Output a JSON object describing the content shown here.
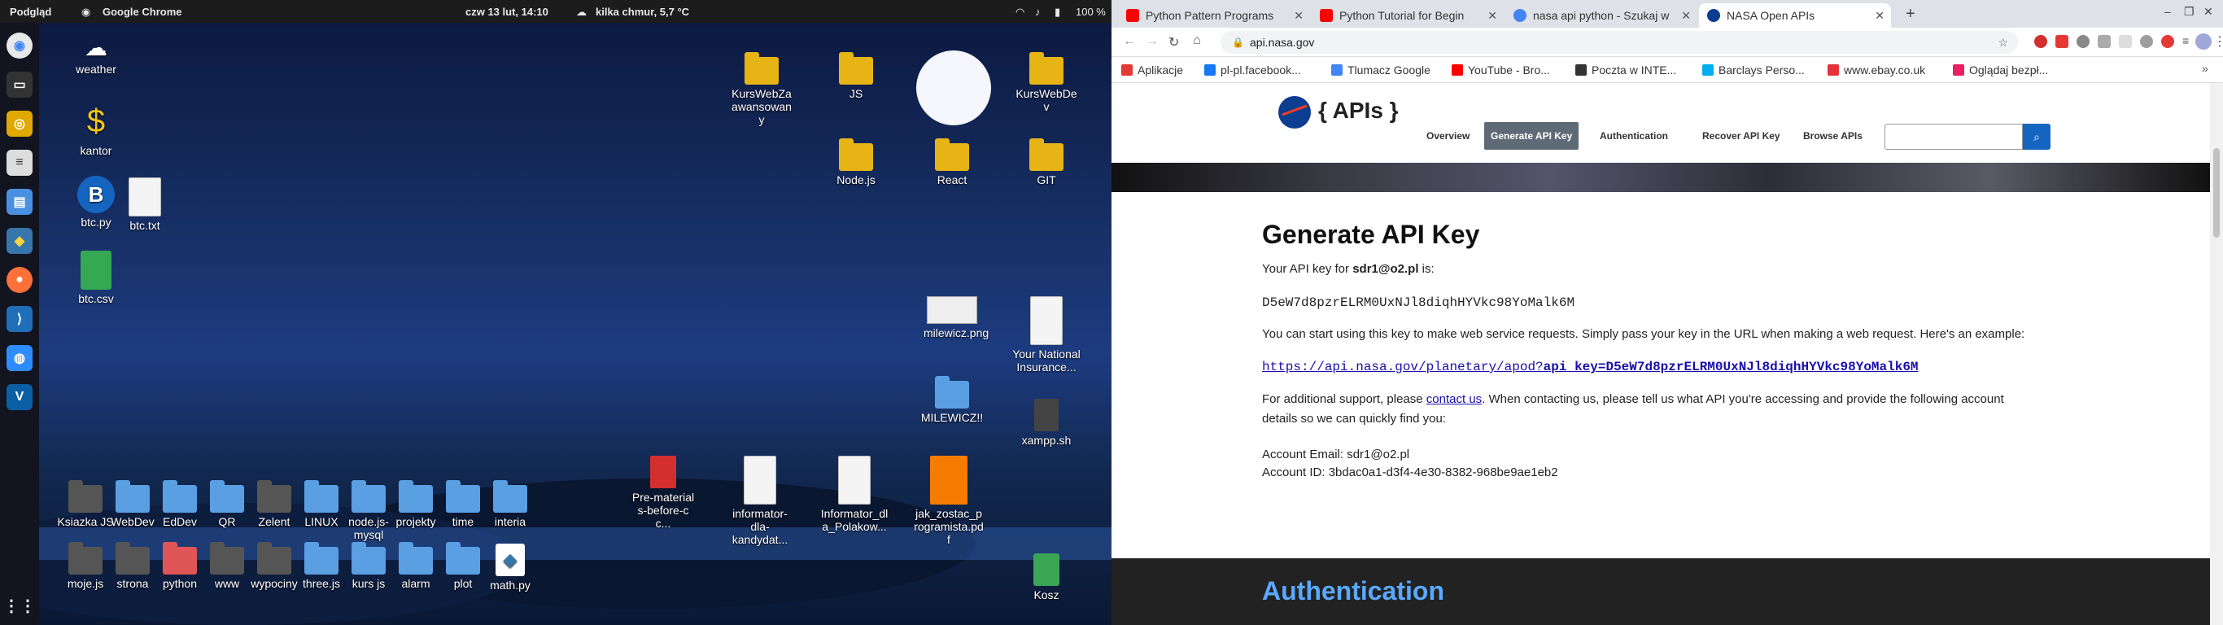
{
  "topbar": {
    "app_menu": "Podgląd",
    "active_app": "Google Chrome",
    "datetime": "czw 13 lut, 14:10",
    "weather": "kilka chmur, 5,7 °C",
    "battery": "100 %"
  },
  "dock": {
    "items": [
      "chrome-icon",
      "terminal-icon",
      "disk-icon",
      "text-editor-icon",
      "files-icon",
      "python-icon",
      "firefox-icon",
      "vscode-icon",
      "chat-icon",
      "vscode-alt-icon"
    ]
  },
  "desktop": {
    "left_icons": [
      {
        "label": "weather"
      },
      {
        "label": "kantor"
      },
      {
        "label": "btc.py"
      },
      {
        "label": "btc.txt"
      },
      {
        "label": "btc.csv"
      }
    ],
    "top_right_icons": [
      {
        "label": "KursWebZaawansowany"
      },
      {
        "label": "JS"
      },
      {
        "label": "KursWebDev"
      },
      {
        "label": "Node.js"
      },
      {
        "label": "React"
      },
      {
        "label": "GIT"
      }
    ],
    "right_icons": [
      {
        "label": "milewicz.png"
      },
      {
        "label": "Your National Insurance..."
      },
      {
        "label": "MILEWICZ!!"
      },
      {
        "label": "xampp.sh"
      }
    ],
    "row1": [
      "Ksiazka JS",
      "WebDev",
      "EdDev",
      "QR",
      "Zelent",
      "LINUX",
      "node.js-mysql",
      "projekty",
      "time",
      "interia"
    ],
    "row2": [
      "moje.js",
      "strona",
      "python",
      "www",
      "wypociny",
      "three.js",
      "kurs js",
      "alarm",
      "plot",
      "math.py"
    ],
    "docs": [
      {
        "label": "Pre-materials-before-cc..."
      },
      {
        "label": "informator-dla-kandydat..."
      },
      {
        "label": "Informator_dla_Polakow..."
      },
      {
        "label": "jak_zostac_programista.pdf"
      }
    ],
    "trash": "Kosz"
  },
  "browser": {
    "tabs": [
      {
        "title": "Python Pattern Programs",
        "favicon": "#ff0000"
      },
      {
        "title": "Python Tutorial for Begin",
        "favicon": "#ff0000"
      },
      {
        "title": "nasa api python - Szukaj w",
        "favicon": "#4285f4"
      },
      {
        "title": "NASA Open APIs",
        "favicon": "#0b3d91"
      }
    ],
    "new_tab": "+",
    "url": "api.nasa.gov",
    "bookmarks": [
      {
        "label": "Aplikacje",
        "color": "#e53935"
      },
      {
        "label": "pl-pl.facebook...",
        "color": "#1877f2"
      },
      {
        "label": "Tlumacz Google",
        "color": "#4285f4"
      },
      {
        "label": "YouTube - Bro...",
        "color": "#ff0000"
      },
      {
        "label": "Poczta w INTE...",
        "color": "#333333"
      },
      {
        "label": "Barclays Perso...",
        "color": "#00aeef"
      },
      {
        "label": "www.ebay.co.uk",
        "color": "#e53238"
      },
      {
        "label": "Oglądaj bezpł...",
        "color": "#e91e63"
      }
    ]
  },
  "nasa": {
    "logo_text": "{ APIs }",
    "nav": [
      "Overview",
      "Generate API Key",
      "Authentication",
      "Recover API Key",
      "Browse APIs"
    ],
    "search_placeholder": "",
    "heading": "Generate API Key",
    "key_intro_prefix": "Your API key for ",
    "email": "sdr1@o2.pl",
    "key_intro_suffix": " is:",
    "api_key": "D5eW7d8pzrELRM0UxNJl8diqhHYVkc98YoMalk6M",
    "usage_text": "You can start using this key to make web service requests. Simply pass your key in the URL when making a web request. Here's an example:",
    "example_url_prefix": "https://api.nasa.gov/planetary/apod?",
    "example_url_param": "api_key=D5eW7d8pzrELRM0UxNJl8diqhHYVkc98YoMalk6M",
    "support_prefix": "For additional support, please ",
    "support_link": "contact us",
    "support_suffix": ". When contacting us, please tell us what API you're accessing and provide the following account",
    "support_line2": "details so we can quickly find you:",
    "account_email": "Account Email: sdr1@o2.pl",
    "account_id": "Account ID: 3bdac0a1-d3f4-4e30-8382-968be9ae1eb2",
    "section2_heading": "Authentication"
  }
}
